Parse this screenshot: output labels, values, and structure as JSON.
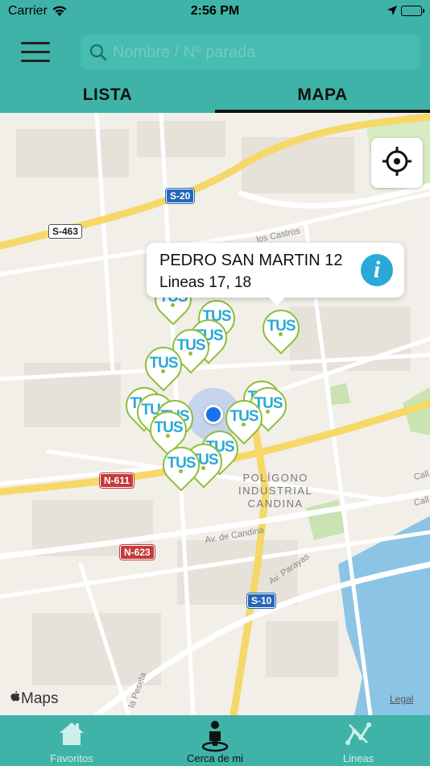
{
  "status_bar": {
    "carrier": "Carrier",
    "time": "2:56 PM"
  },
  "search": {
    "placeholder": "Nombre / Nº parada"
  },
  "tabs": [
    {
      "label": "LISTA"
    },
    {
      "label": "MAPA"
    }
  ],
  "active_tab": "MAPA",
  "map": {
    "callout": {
      "stop_name": "PEDRO SAN MARTIN 12",
      "lines": "Lineas 17, 18",
      "info_glyph": "i"
    },
    "pin_label": "TUS",
    "road_labels": {
      "s20": "S-20",
      "s463": "S-463",
      "n611": "N-611",
      "n623": "N-623",
      "s10": "S-10"
    },
    "area_label": [
      "POLÍGONO",
      "INDUSTRIAL",
      "CANDINA"
    ],
    "streets": {
      "castros": "los Castros",
      "candina": "Av. de Candina",
      "parayas": "Av. Parayas",
      "peseta": "la Peseta",
      "calle1": "Call",
      "calle2": "Call"
    },
    "attribution": "Maps",
    "legal": "Legal"
  },
  "bottom_nav": [
    {
      "label": "Favoritos",
      "icon": "home-icon"
    },
    {
      "label": "Cerca de mi",
      "icon": "person-pin-icon"
    },
    {
      "label": "Lineas",
      "icon": "route-icon"
    }
  ],
  "colors": {
    "teal": "#3fb3a8",
    "pin_border": "#8fbf3a",
    "pin_text": "#2aa9d6",
    "user_dot": "#1a73e8"
  }
}
